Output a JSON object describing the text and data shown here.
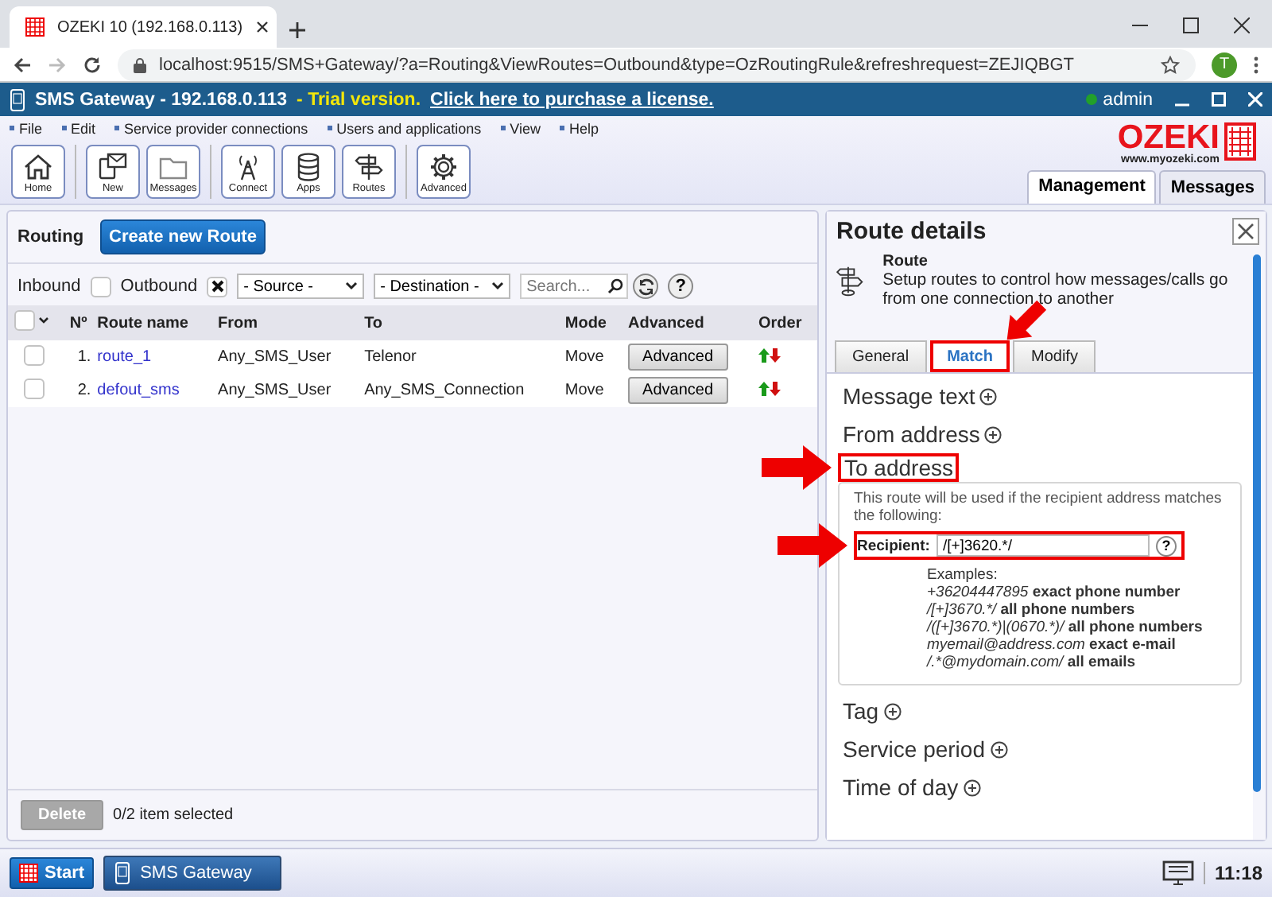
{
  "browser": {
    "tab_title": "OZEKI 10 (192.168.0.113)",
    "url": "localhost:9515/SMS+Gateway/?a=Routing&ViewRoutes=Outbound&type=OzRoutingRule&refreshrequest=ZEJIQBGT",
    "profile": "T"
  },
  "app_bar": {
    "title": "SMS Gateway - 192.168.0.113",
    "trial": "- Trial version.",
    "license_link": "Click here to purchase a license.",
    "user": "admin",
    "online": true
  },
  "menu": [
    "File",
    "Edit",
    "Service provider connections",
    "Users and applications",
    "View",
    "Help"
  ],
  "toolbar": [
    [
      {
        "label": "Home",
        "kind": "home"
      }
    ],
    [
      {
        "label": "New",
        "kind": "new"
      },
      {
        "label": "Messages",
        "kind": "folder"
      }
    ],
    [
      {
        "label": "Connect",
        "kind": "antenna"
      },
      {
        "label": "Apps",
        "kind": "database"
      },
      {
        "label": "Routes",
        "kind": "signpost"
      }
    ],
    [
      {
        "label": "Advanced",
        "kind": "gear"
      }
    ]
  ],
  "logo": {
    "name": "OZEKI",
    "site": "www.myozeki.com"
  },
  "main_tabs": [
    {
      "label": "Management",
      "selected": true
    },
    {
      "label": "Messages",
      "selected": false
    }
  ],
  "routing": {
    "title": "Routing",
    "create_button": "Create new Route",
    "filters": {
      "inbound": {
        "label": "Inbound",
        "checked": false
      },
      "outbound": {
        "label": "Outbound",
        "checked": true
      },
      "source": "- Source -",
      "destination": "- Destination -",
      "search_placeholder": "Search...",
      "help": "?"
    },
    "select_all": {
      "checked": false
    },
    "columns": [
      "Nº",
      "Route name",
      "From",
      "To",
      "Mode",
      "Advanced",
      "Order"
    ],
    "rows": [
      {
        "selected": false,
        "number": "1.",
        "name": "route_1",
        "from": "Any_SMS_User",
        "to": "Telenor",
        "mode": "Move",
        "advanced": "Advanced"
      },
      {
        "selected": false,
        "number": "2.",
        "name": "defout_sms",
        "from": "Any_SMS_User",
        "to": "Any_SMS_Connection",
        "mode": "Move",
        "advanced": "Advanced"
      }
    ],
    "delete_button": {
      "label": "Delete",
      "disabled": true
    },
    "selection_status": "0/2 item selected"
  },
  "details": {
    "title": "Route details",
    "info": {
      "title": "Route",
      "description": "Setup routes to control how messages/calls go from one connection to another"
    },
    "tabs": [
      {
        "label": "General",
        "selected": false,
        "highlighted": false
      },
      {
        "label": "Match",
        "selected": true,
        "highlighted": true
      },
      {
        "label": "Modify",
        "selected": false,
        "highlighted": false
      }
    ],
    "sections": [
      {
        "title": "Message text",
        "expanded": false,
        "highlighted": false
      },
      {
        "title": "From address",
        "expanded": false,
        "highlighted": false
      },
      {
        "title": "To address",
        "expanded": true,
        "highlighted": true,
        "hint": "This route will be used if the recipient address matches the following:",
        "field": {
          "label": "Recipient:",
          "value": "/[+]3620.*/",
          "highlighted": true,
          "help": "?"
        },
        "examples_title": "Examples:",
        "examples": [
          {
            "pattern": "+36204447895",
            "meaning": "exact phone number"
          },
          {
            "pattern": "/[+]3670.*/",
            "meaning": "all phone numbers"
          },
          {
            "pattern": "/([+]3670.*)|(0670.*)/",
            "meaning": "all phone numbers"
          },
          {
            "pattern": "myemail@address.com",
            "meaning": "exact e-mail"
          },
          {
            "pattern": "/.*@mydomain.com/",
            "meaning": "all emails"
          }
        ]
      },
      {
        "title": "Tag",
        "expanded": false,
        "highlighted": false
      },
      {
        "title": "Service period",
        "expanded": false,
        "highlighted": false
      },
      {
        "title": "Time of day",
        "expanded": false,
        "highlighted": false
      }
    ]
  },
  "taskbar": {
    "start": "Start",
    "apps": [
      {
        "label": "SMS Gateway",
        "selected": true
      }
    ],
    "clock": "11:18"
  }
}
